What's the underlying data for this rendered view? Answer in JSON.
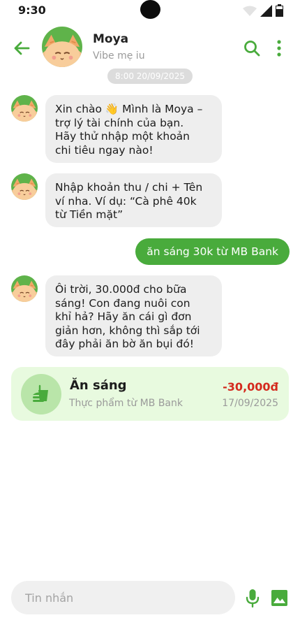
{
  "status_bar": {
    "time": "9:30"
  },
  "header": {
    "name": "Moya",
    "subtitle": "Vibe mẹ iu",
    "icons": [
      "back-arrow-icon",
      "search-icon",
      "more-vertical-icon"
    ]
  },
  "timestamp": "8:00 20/09/2025",
  "messages": [
    {
      "sender": "bot",
      "lines": [
        "Xin chào 👋 Mình là Moya –",
        "trợ lý tài chính của bạn.",
        "Hãy thử nhập một khoản",
        "chi tiêu ngay nào!"
      ]
    },
    {
      "sender": "bot",
      "lines": [
        "Nhập khoản thu / chi + Tên",
        "ví nha. Ví dụ: “Cà phê 40k",
        "từ Tiền mặt”"
      ]
    },
    {
      "sender": "user",
      "text": "ăn sáng 30k từ MB Bank"
    },
    {
      "sender": "bot",
      "lines": [
        "Ôi trời, 30.000đ cho bữa",
        "sáng! Con đang nuôi con",
        "khỉ hả? Hãy ăn cái gì đơn",
        "giản hơn, không thì sắp tới",
        "đây phải ăn bờ ăn bụi đó!"
      ]
    }
  ],
  "transaction": {
    "title": "Ăn sáng",
    "description": "Thực phẩm từ MB Bank",
    "amount": "-30,000đ",
    "date": "17/09/2025",
    "icon": "food-icon"
  },
  "composer": {
    "placeholder": "Tin nhắn"
  },
  "colors": {
    "accent": "#49ab3c",
    "negative_amount": "#d42a1e",
    "card_bg": "#e8fadf",
    "bot_bubble": "#eeeeee"
  }
}
